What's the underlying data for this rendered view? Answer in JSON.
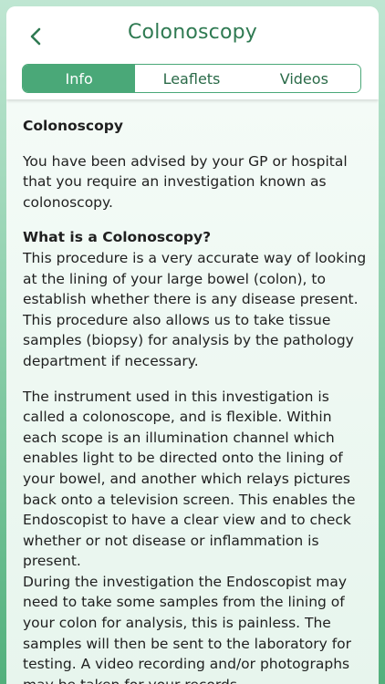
{
  "header": {
    "title": "Colonoscopy",
    "back_icon": "chevron-left-icon"
  },
  "tabs": [
    {
      "label": "Info",
      "active": true
    },
    {
      "label": "Leaflets",
      "active": false
    },
    {
      "label": "Videos",
      "active": false
    }
  ],
  "colors": {
    "accent": "#4aa878",
    "title": "#2f7a52"
  },
  "content": {
    "heading": "Colonoscopy",
    "intro": "You have been advised by your GP or hospital that you require an investigation known as colonoscopy.",
    "subheading": "What is a Colonoscopy?",
    "para1": "This procedure is a very accurate way of looking at the lining of your large bowel (colon), to establish whether there is any disease present.  This procedure also allows us to take tissue samples (biopsy) for analysis by the pathology department if necessary.",
    "para2": "The instrument used in this investigation is called a colonoscope, and is flexible. Within each scope is an illumination channel which enables light to be directed onto the lining of your bowel, and another which relays pictures back onto a television screen. This enables the Endoscopist to have a clear view and to check whether or not disease or inflammation is present.",
    "para3": "During the investigation the Endoscopist may need to take some samples from the lining of your colon for analysis, this is painless. The samples will then be sent to the laboratory for testing. A video recording and/or photographs may be taken for your records."
  }
}
